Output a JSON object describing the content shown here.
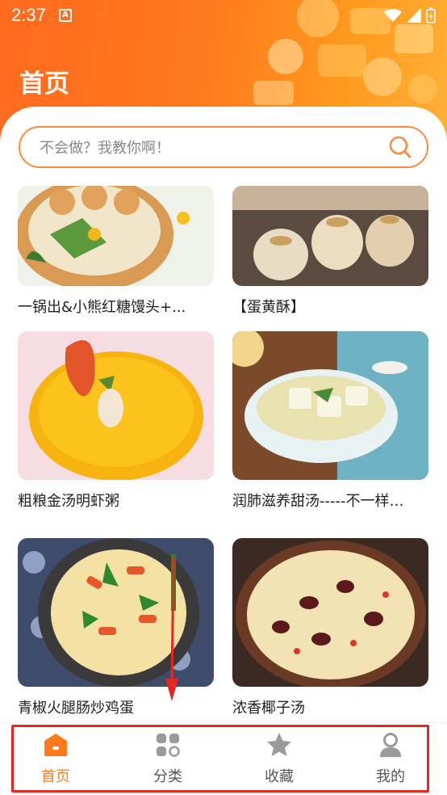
{
  "status_bar": {
    "time": "2:37",
    "notification_icon": "A"
  },
  "header": {
    "title": "首页"
  },
  "search": {
    "placeholder": "不会做？我教你啊！",
    "icon": "search-icon"
  },
  "recipes": [
    {
      "title": "一锅出&小熊红糖馒头+..."
    },
    {
      "title": "【蛋黄酥】"
    },
    {
      "title": "粗粮金汤明虾粥"
    },
    {
      "title": "润肺滋养甜汤-----不一样…"
    },
    {
      "title": "青椒火腿肠炒鸡蛋"
    },
    {
      "title": "浓香椰子汤"
    }
  ],
  "tabs": [
    {
      "label": "首页",
      "icon": "home-icon",
      "active": true
    },
    {
      "label": "分类",
      "icon": "category-icon",
      "active": false
    },
    {
      "label": "收藏",
      "icon": "star-icon",
      "active": false
    },
    {
      "label": "我的",
      "icon": "user-icon",
      "active": false
    }
  ],
  "colors": {
    "accent": "#ff7a1c",
    "highlight_frame": "#e8251f"
  }
}
